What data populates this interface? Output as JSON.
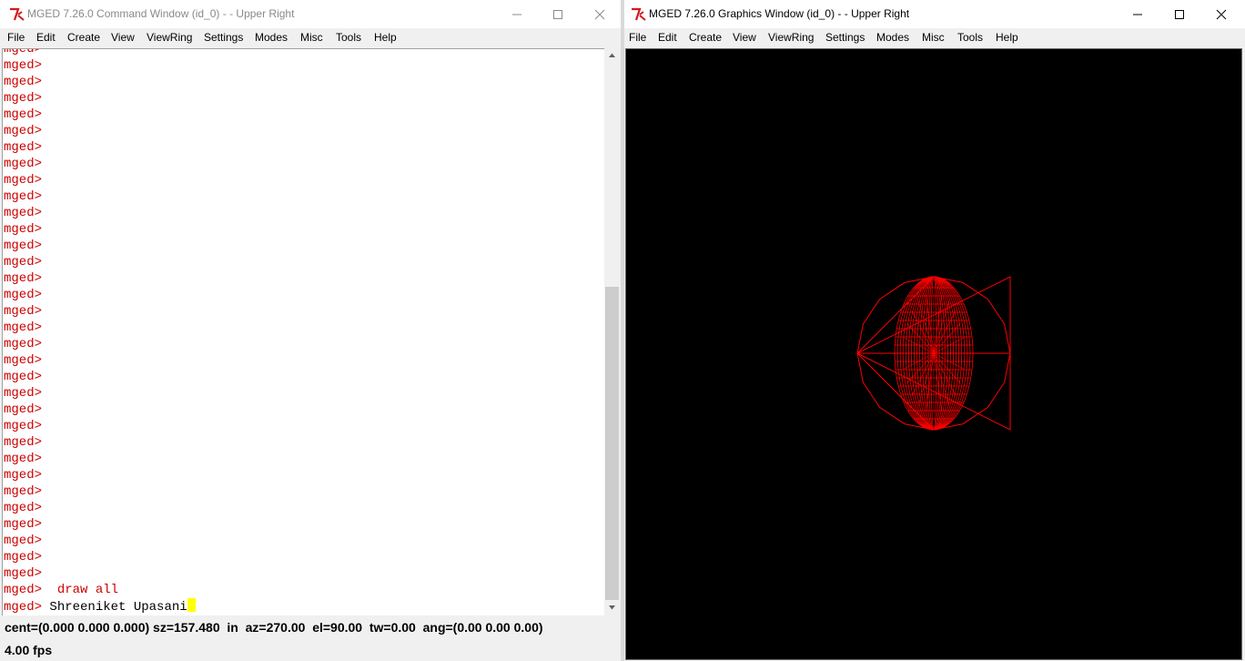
{
  "command_window": {
    "title": "MGED 7.26.0 Command Window (id_0) -  - Upper Right",
    "menu": [
      "File",
      "Edit",
      "Create",
      "View",
      "ViewRing",
      "Settings",
      "Modes",
      "Misc",
      "Tools",
      "Help"
    ],
    "console": {
      "prompt": "mged>",
      "previous_command": "draw all",
      "current_input": "Shreeniket Upasani"
    },
    "status_line": "cent=(0.000 0.000 0.000) sz=157.480  in  az=270.00  el=90.00  tw=0.00  ang=(0.00 0.00 0.00)",
    "fps": "4.00 fps"
  },
  "graphics_window": {
    "title": "MGED 7.26.0 Graphics Window (id_0) -  - Upper Right",
    "menu": [
      "File",
      "Edit",
      "Create",
      "View",
      "ViewRing",
      "Settings",
      "Modes",
      "Misc",
      "Tools",
      "Help"
    ],
    "wireframe_color": "#ff0000",
    "background_color": "#000000"
  },
  "icons": {
    "app": "tk-feather-icon",
    "minimize": "minimize-icon",
    "maximize": "maximize-icon",
    "close": "close-icon"
  }
}
